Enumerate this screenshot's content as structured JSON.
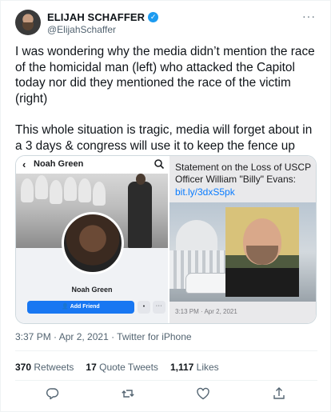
{
  "author": {
    "display_name": "ELIJAH SCHAFFER",
    "handle": "@ElijahSchaffer",
    "verified_badge": "✓"
  },
  "menu": {
    "more": "···"
  },
  "tweet": {
    "paragraphs": [
      "I was wondering why the media didn’t mention the race of the homicidal man (left) who attacked the Capitol today nor did they mentioned the race of the victim (right)",
      "This whole situation is tragic, media will forget about in a 3 days & congress will use it to keep the fence up"
    ]
  },
  "media": {
    "left": {
      "back": "‹",
      "profile_title": "Noah Green",
      "profile_name": "Noah Green",
      "add_friend": "Add Friend",
      "message_icon": "•",
      "more": "···"
    },
    "right": {
      "message": "Statement on the Loss of USCP Officer William \"Billy\" Evans:",
      "link": "bit.ly/3dxS5pk",
      "time": "3:13 PM · Apr 2, 2021"
    }
  },
  "meta": {
    "timestamp": "3:37 PM · Apr 2, 2021 · Twitter for iPhone"
  },
  "stats": {
    "retweets_count": "370",
    "retweets_label": "Retweets",
    "quotes_count": "17",
    "quotes_label": "Quote Tweets",
    "likes_count": "1,117",
    "likes_label": "Likes"
  },
  "actions": [
    "reply-icon",
    "retweet-icon",
    "like-icon",
    "share-icon"
  ],
  "colors": {
    "accent": "#1d9bf0",
    "facebook_blue": "#1877f2",
    "muted_text": "#536471",
    "imessage_link": "#0a7cff"
  }
}
